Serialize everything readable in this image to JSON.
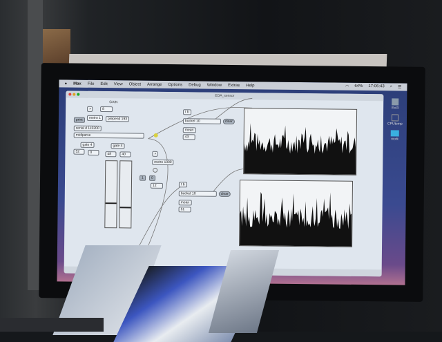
{
  "menubar": {
    "items": [
      "Max",
      "File",
      "Edit",
      "View",
      "Object",
      "Arrange",
      "Options",
      "Debug",
      "Window",
      "Extras",
      "Help"
    ],
    "battery": "64%",
    "clock": "17:06:43"
  },
  "window": {
    "title": "EDA_sensor"
  },
  "patch": {
    "gain_label": "GAIN",
    "gain_value": "8",
    "metro1": "metro 1",
    "prepend": "prepend 193",
    "print": "print",
    "serial": "serial d 115200",
    "midiparse": "midiparse",
    "gate1": "gate 4",
    "gate2": "gate 4",
    "num_a": "52",
    "num_b": "0",
    "num_c": "48",
    "num_d": "40",
    "metro1000": "metro 1000",
    "num_1": "1",
    "num_0": "0",
    "num_12": "12",
    "top": {
      "trigger": "t b",
      "bucket": "bucket 10",
      "clear": "clear",
      "mean": "mean",
      "value": "43"
    },
    "bottom": {
      "trigger": "t b",
      "bucket": "bucket 10",
      "clear": "clear",
      "mean": "mean",
      "value": "51"
    }
  },
  "desktop": {
    "icons": [
      "Ext3",
      "CPUtemp",
      "work"
    ]
  }
}
